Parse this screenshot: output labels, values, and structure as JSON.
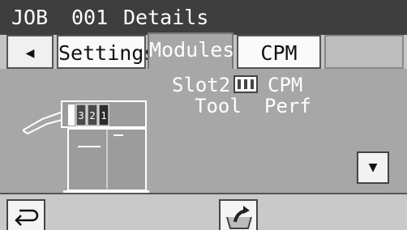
{
  "title_bar": {
    "job_label": "JOB",
    "job_number": "001",
    "screen_name": "Details"
  },
  "tabs": {
    "back_icon": "left-triangle-icon",
    "settings_label": "Settings",
    "modules_label": "Modules",
    "cpm_label": "CPM"
  },
  "module": {
    "slot_label": "Slot2",
    "slot_value": "CPM",
    "tool_label": "Tool",
    "tool_value": "Perf",
    "stack_numbers": [
      "3",
      "2",
      "1"
    ],
    "slot_icon": "module-card-icon"
  },
  "controls": {
    "scroll_down_icon": "down-triangle-icon",
    "return_icon": "return-arrow-icon",
    "export_icon": "export-arrow-icon"
  }
}
